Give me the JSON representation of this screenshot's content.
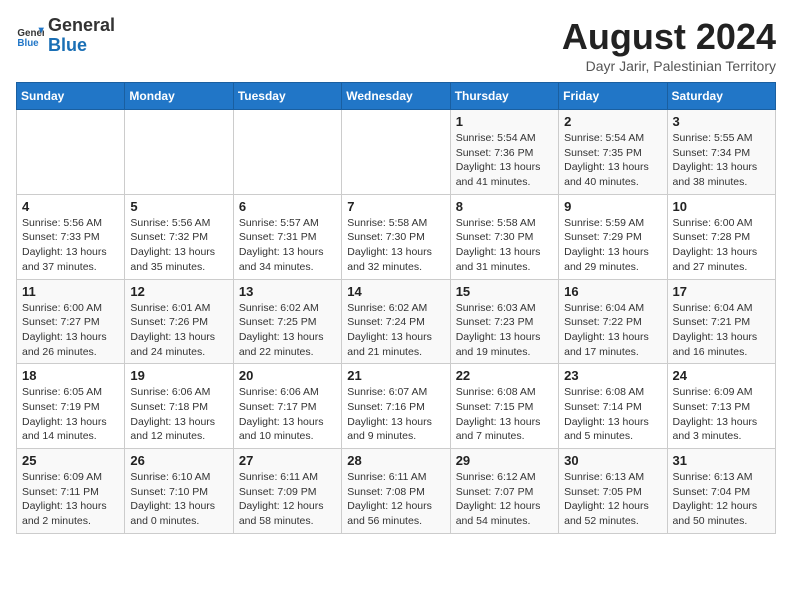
{
  "header": {
    "logo_line1": "General",
    "logo_line2": "Blue",
    "title": "August 2024",
    "subtitle": "Dayr Jarir, Palestinian Territory"
  },
  "days_of_week": [
    "Sunday",
    "Monday",
    "Tuesday",
    "Wednesday",
    "Thursday",
    "Friday",
    "Saturday"
  ],
  "weeks": [
    [
      {
        "day": "",
        "content": ""
      },
      {
        "day": "",
        "content": ""
      },
      {
        "day": "",
        "content": ""
      },
      {
        "day": "",
        "content": ""
      },
      {
        "day": "1",
        "content": "Sunrise: 5:54 AM\nSunset: 7:36 PM\nDaylight: 13 hours and 41 minutes."
      },
      {
        "day": "2",
        "content": "Sunrise: 5:54 AM\nSunset: 7:35 PM\nDaylight: 13 hours and 40 minutes."
      },
      {
        "day": "3",
        "content": "Sunrise: 5:55 AM\nSunset: 7:34 PM\nDaylight: 13 hours and 38 minutes."
      }
    ],
    [
      {
        "day": "4",
        "content": "Sunrise: 5:56 AM\nSunset: 7:33 PM\nDaylight: 13 hours and 37 minutes."
      },
      {
        "day": "5",
        "content": "Sunrise: 5:56 AM\nSunset: 7:32 PM\nDaylight: 13 hours and 35 minutes."
      },
      {
        "day": "6",
        "content": "Sunrise: 5:57 AM\nSunset: 7:31 PM\nDaylight: 13 hours and 34 minutes."
      },
      {
        "day": "7",
        "content": "Sunrise: 5:58 AM\nSunset: 7:30 PM\nDaylight: 13 hours and 32 minutes."
      },
      {
        "day": "8",
        "content": "Sunrise: 5:58 AM\nSunset: 7:30 PM\nDaylight: 13 hours and 31 minutes."
      },
      {
        "day": "9",
        "content": "Sunrise: 5:59 AM\nSunset: 7:29 PM\nDaylight: 13 hours and 29 minutes."
      },
      {
        "day": "10",
        "content": "Sunrise: 6:00 AM\nSunset: 7:28 PM\nDaylight: 13 hours and 27 minutes."
      }
    ],
    [
      {
        "day": "11",
        "content": "Sunrise: 6:00 AM\nSunset: 7:27 PM\nDaylight: 13 hours and 26 minutes."
      },
      {
        "day": "12",
        "content": "Sunrise: 6:01 AM\nSunset: 7:26 PM\nDaylight: 13 hours and 24 minutes."
      },
      {
        "day": "13",
        "content": "Sunrise: 6:02 AM\nSunset: 7:25 PM\nDaylight: 13 hours and 22 minutes."
      },
      {
        "day": "14",
        "content": "Sunrise: 6:02 AM\nSunset: 7:24 PM\nDaylight: 13 hours and 21 minutes."
      },
      {
        "day": "15",
        "content": "Sunrise: 6:03 AM\nSunset: 7:23 PM\nDaylight: 13 hours and 19 minutes."
      },
      {
        "day": "16",
        "content": "Sunrise: 6:04 AM\nSunset: 7:22 PM\nDaylight: 13 hours and 17 minutes."
      },
      {
        "day": "17",
        "content": "Sunrise: 6:04 AM\nSunset: 7:21 PM\nDaylight: 13 hours and 16 minutes."
      }
    ],
    [
      {
        "day": "18",
        "content": "Sunrise: 6:05 AM\nSunset: 7:19 PM\nDaylight: 13 hours and 14 minutes."
      },
      {
        "day": "19",
        "content": "Sunrise: 6:06 AM\nSunset: 7:18 PM\nDaylight: 13 hours and 12 minutes."
      },
      {
        "day": "20",
        "content": "Sunrise: 6:06 AM\nSunset: 7:17 PM\nDaylight: 13 hours and 10 minutes."
      },
      {
        "day": "21",
        "content": "Sunrise: 6:07 AM\nSunset: 7:16 PM\nDaylight: 13 hours and 9 minutes."
      },
      {
        "day": "22",
        "content": "Sunrise: 6:08 AM\nSunset: 7:15 PM\nDaylight: 13 hours and 7 minutes."
      },
      {
        "day": "23",
        "content": "Sunrise: 6:08 AM\nSunset: 7:14 PM\nDaylight: 13 hours and 5 minutes."
      },
      {
        "day": "24",
        "content": "Sunrise: 6:09 AM\nSunset: 7:13 PM\nDaylight: 13 hours and 3 minutes."
      }
    ],
    [
      {
        "day": "25",
        "content": "Sunrise: 6:09 AM\nSunset: 7:11 PM\nDaylight: 13 hours and 2 minutes."
      },
      {
        "day": "26",
        "content": "Sunrise: 6:10 AM\nSunset: 7:10 PM\nDaylight: 13 hours and 0 minutes."
      },
      {
        "day": "27",
        "content": "Sunrise: 6:11 AM\nSunset: 7:09 PM\nDaylight: 12 hours and 58 minutes."
      },
      {
        "day": "28",
        "content": "Sunrise: 6:11 AM\nSunset: 7:08 PM\nDaylight: 12 hours and 56 minutes."
      },
      {
        "day": "29",
        "content": "Sunrise: 6:12 AM\nSunset: 7:07 PM\nDaylight: 12 hours and 54 minutes."
      },
      {
        "day": "30",
        "content": "Sunrise: 6:13 AM\nSunset: 7:05 PM\nDaylight: 12 hours and 52 minutes."
      },
      {
        "day": "31",
        "content": "Sunrise: 6:13 AM\nSunset: 7:04 PM\nDaylight: 12 hours and 50 minutes."
      }
    ]
  ]
}
